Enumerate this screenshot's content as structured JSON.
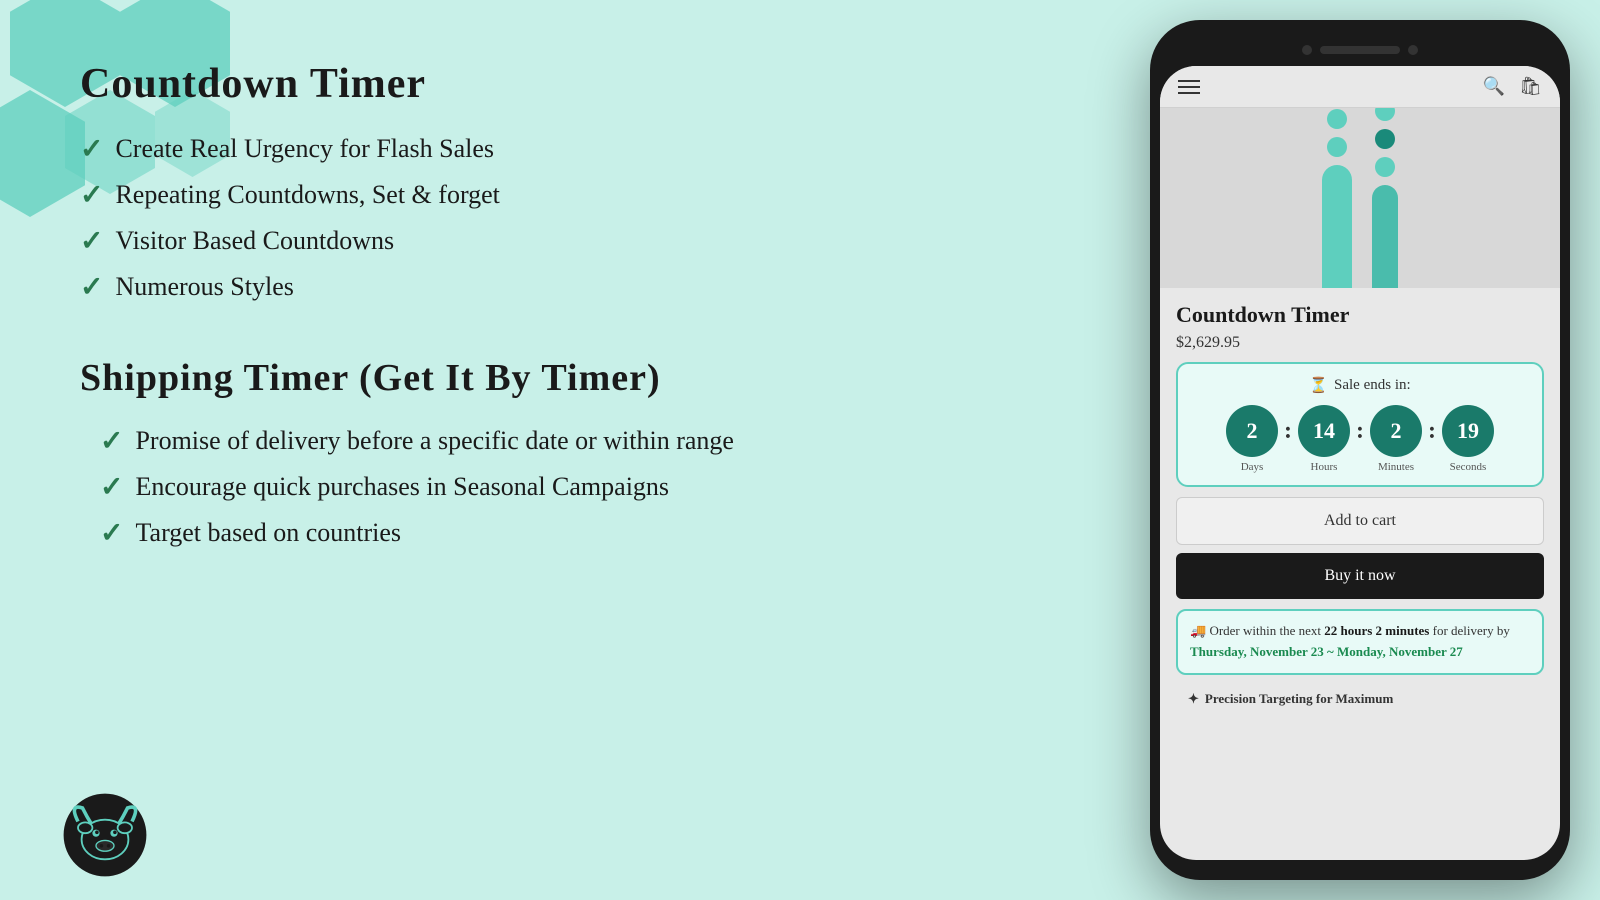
{
  "hexagons": {
    "count": 5
  },
  "left": {
    "section1": {
      "title": "Countdown Timer",
      "features": [
        "Create Real Urgency for Flash Sales",
        "Repeating Countdowns, Set & forget",
        "Visitor Based Countdowns",
        "Numerous Styles"
      ]
    },
    "section2": {
      "title": "Shipping Timer (Get It By Timer)",
      "features": [
        "Promise of delivery before a specific date or within range",
        "Encourage quick purchases in Seasonal Campaigns",
        "Target based on countries"
      ]
    }
  },
  "phone": {
    "product": {
      "name": "Countdown Timer",
      "price": "$2,629.95"
    },
    "countdown": {
      "header_icon": "⏳",
      "header_text": "Sale ends in:",
      "days": "2",
      "days_label": "Days",
      "hours": "14",
      "hours_label": "Hours",
      "minutes": "2",
      "minutes_label": "Minutes",
      "seconds": "19",
      "seconds_label": "Seconds"
    },
    "buttons": {
      "add_to_cart": "Add to cart",
      "buy_now": "Buy it now"
    },
    "shipping": {
      "truck_icon": "🚚",
      "text_start": "Order within the next ",
      "bold_time": "22 hours 2 minutes",
      "text_mid": " for delivery by ",
      "date_range": "Thursday, November 23 ~ Monday, November 27"
    },
    "precision": {
      "star_icon": "✦",
      "text": "Precision Targeting for Maximum"
    }
  },
  "colors": {
    "teal": "#5ecfbe",
    "dark_teal": "#1a7a6a",
    "green_text": "#1a8a50",
    "date_teal": "#0a7a6a",
    "bg": "#c8f0e8",
    "dark": "#1a1a1a"
  }
}
